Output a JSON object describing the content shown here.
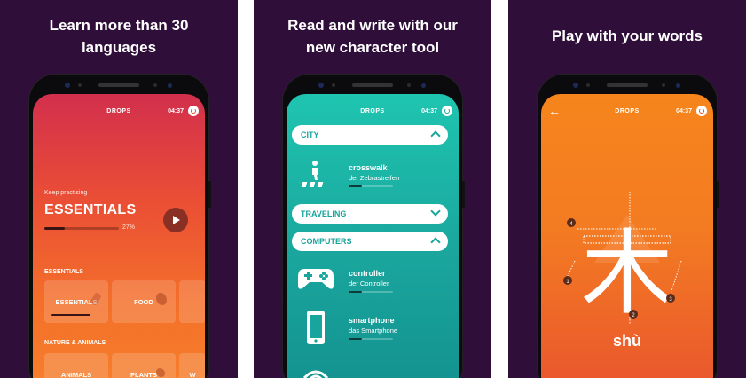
{
  "panels": [
    {
      "caption": [
        "Learn more than 30",
        "languages"
      ],
      "status": {
        "brand": "DROPS",
        "time": "04:37"
      },
      "keep_label": "Keep practising",
      "title": "ESSENTIALS",
      "progress": {
        "value": 0.27,
        "label": "27%"
      },
      "sections": [
        {
          "label": "ESSENTIALS",
          "cards": [
            "ESSENTIALS",
            "FOOD",
            ""
          ]
        },
        {
          "label": "NATURE & ANIMALS",
          "cards": [
            "ANIMALS",
            "PLANTS",
            "W"
          ]
        }
      ]
    },
    {
      "caption": [
        "Read and write with our",
        "new character tool"
      ],
      "status": {
        "brand": "DROPS",
        "time": "04:37"
      },
      "categories": [
        {
          "label": "CITY",
          "state": "expanded"
        },
        {
          "label": "TRAVELING",
          "state": "collapsed"
        },
        {
          "label": "COMPUTERS",
          "state": "expanded"
        }
      ],
      "words": [
        {
          "word": "crosswalk",
          "translation": "der Zebrastreifen",
          "icon": "crosswalk-icon",
          "progress": 0.3
        },
        {
          "word": "controller",
          "translation": "der Controller",
          "icon": "gamepad-icon",
          "progress": 0.3
        },
        {
          "word": "smartphone",
          "translation": "das Smartphone",
          "icon": "smartphone-icon",
          "progress": 0.3
        }
      ]
    },
    {
      "caption": [
        "Play with your words"
      ],
      "status": {
        "brand": "DROPS",
        "time": "04:37"
      },
      "character": "木",
      "stroke_numbers": [
        "1",
        "2",
        "3",
        "4"
      ],
      "syllable": "shù"
    }
  ],
  "colors": {
    "background": "#2f0f3a",
    "teal": "#17a59c",
    "orange": "#f37b22",
    "red": "#d22f4d"
  }
}
